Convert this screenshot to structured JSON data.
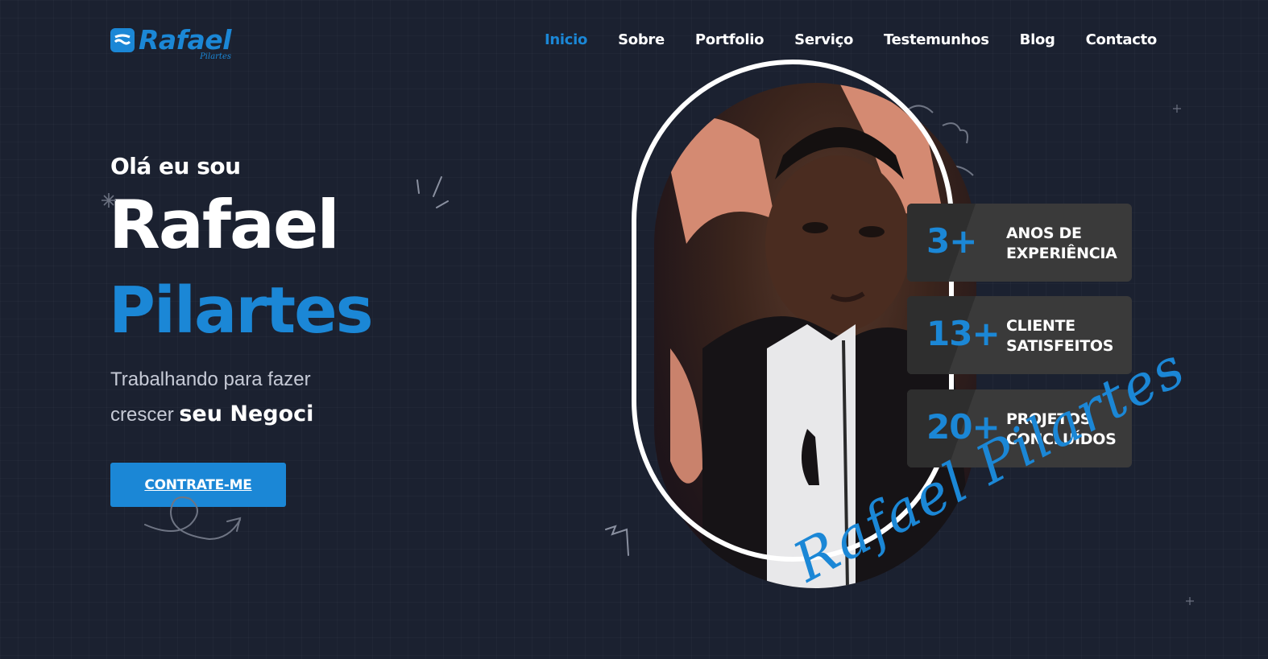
{
  "brand": {
    "name": "Rafael",
    "sub": "Pilartes"
  },
  "nav": [
    {
      "label": "Inicio",
      "active": true
    },
    {
      "label": "Sobre"
    },
    {
      "label": "Portfolio"
    },
    {
      "label": "Serviço"
    },
    {
      "label": "Testemunhos"
    },
    {
      "label": "Blog"
    },
    {
      "label": "Contacto"
    }
  ],
  "hero": {
    "greeting": "Olá eu sou",
    "first_name": "Rafael",
    "last_name": "Pilartes",
    "tagline_line1": "Trabalhando para fazer",
    "tagline_line2_plain": "crescer",
    "tagline_line2_strong": "seu Negoci",
    "cta": "CONTRATE-ME"
  },
  "stats": [
    {
      "number": "3+",
      "line1": "ANOS DE",
      "line2": "EXPERIÊNCIA"
    },
    {
      "number": "13+",
      "line1": "CLIENTE",
      "line2": "SATISFEITOS"
    },
    {
      "number": "20+",
      "line1": "PROJETOS",
      "line2": "CONCLUÍDOS"
    }
  ],
  "signature": "Rafael Pilartes",
  "colors": {
    "accent": "#1b87d6",
    "background": "#1b2130",
    "card": "#3a3a3a"
  }
}
